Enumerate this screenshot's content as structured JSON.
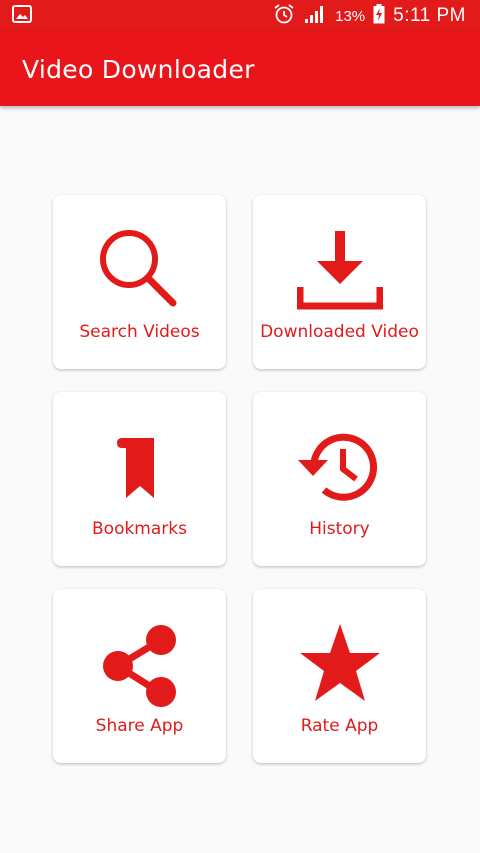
{
  "status_bar": {
    "alarm_icon": "alarm-icon",
    "battery_percent": "13%",
    "time": "5:11 PM"
  },
  "app_bar": {
    "title": "Video Downloader"
  },
  "colors": {
    "accent": "#e9151b",
    "background": "#fafafa",
    "card": "#ffffff"
  },
  "menu": {
    "items": [
      {
        "label": "Search Videos",
        "icon": "search-icon"
      },
      {
        "label": "Downloaded Video",
        "icon": "download-icon"
      },
      {
        "label": "Bookmarks",
        "icon": "bookmark-icon"
      },
      {
        "label": "History",
        "icon": "history-icon"
      },
      {
        "label": "Share App",
        "icon": "share-icon"
      },
      {
        "label": "Rate App",
        "icon": "star-icon"
      }
    ]
  }
}
